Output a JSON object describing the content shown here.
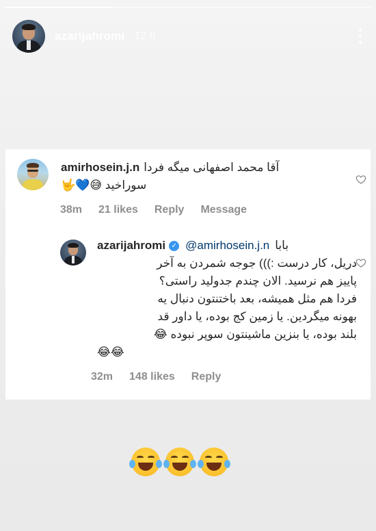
{
  "story": {
    "progress": 0.3,
    "username": "azarijahromi",
    "time_ago": "12 h"
  },
  "comment": {
    "username": "amirhosein.j.n",
    "text_line1": "آقا محمد اصفهانی میگه فردا",
    "text_line2": "سوراخید 😅💙🤟",
    "time": "38m",
    "likes": "21 likes",
    "reply_label": "Reply",
    "message_label": "Message"
  },
  "reply": {
    "username": "azarijahromi",
    "verified_mark": "✓",
    "mention": "@amirhosein.j.n",
    "text_line0": "بابا",
    "text_line1": "دریل، کار درست :))) جوجه شمردن به آخر",
    "text_line2": "پاییز هم نرسید. الان چندم جدولید راستی؟",
    "text_line3": "فردا هم مثل همیشه، بعد باختنتون دنبال یه",
    "text_line4": "بهونه میگردین. یا زمین کج بوده، یا داور قد",
    "text_line5": "بلند بوده، یا بنزین ماشینتون سوپر نبوده 😂",
    "text_line6": "😂😂",
    "time": "32m",
    "likes": "148 likes",
    "reply_label": "Reply"
  },
  "icons": {
    "heart": "heart-icon",
    "more": "more-vertical-icon"
  },
  "colors": {
    "accent": "#3897f0",
    "mention": "#00376b",
    "meta": "#8e8e8e"
  }
}
